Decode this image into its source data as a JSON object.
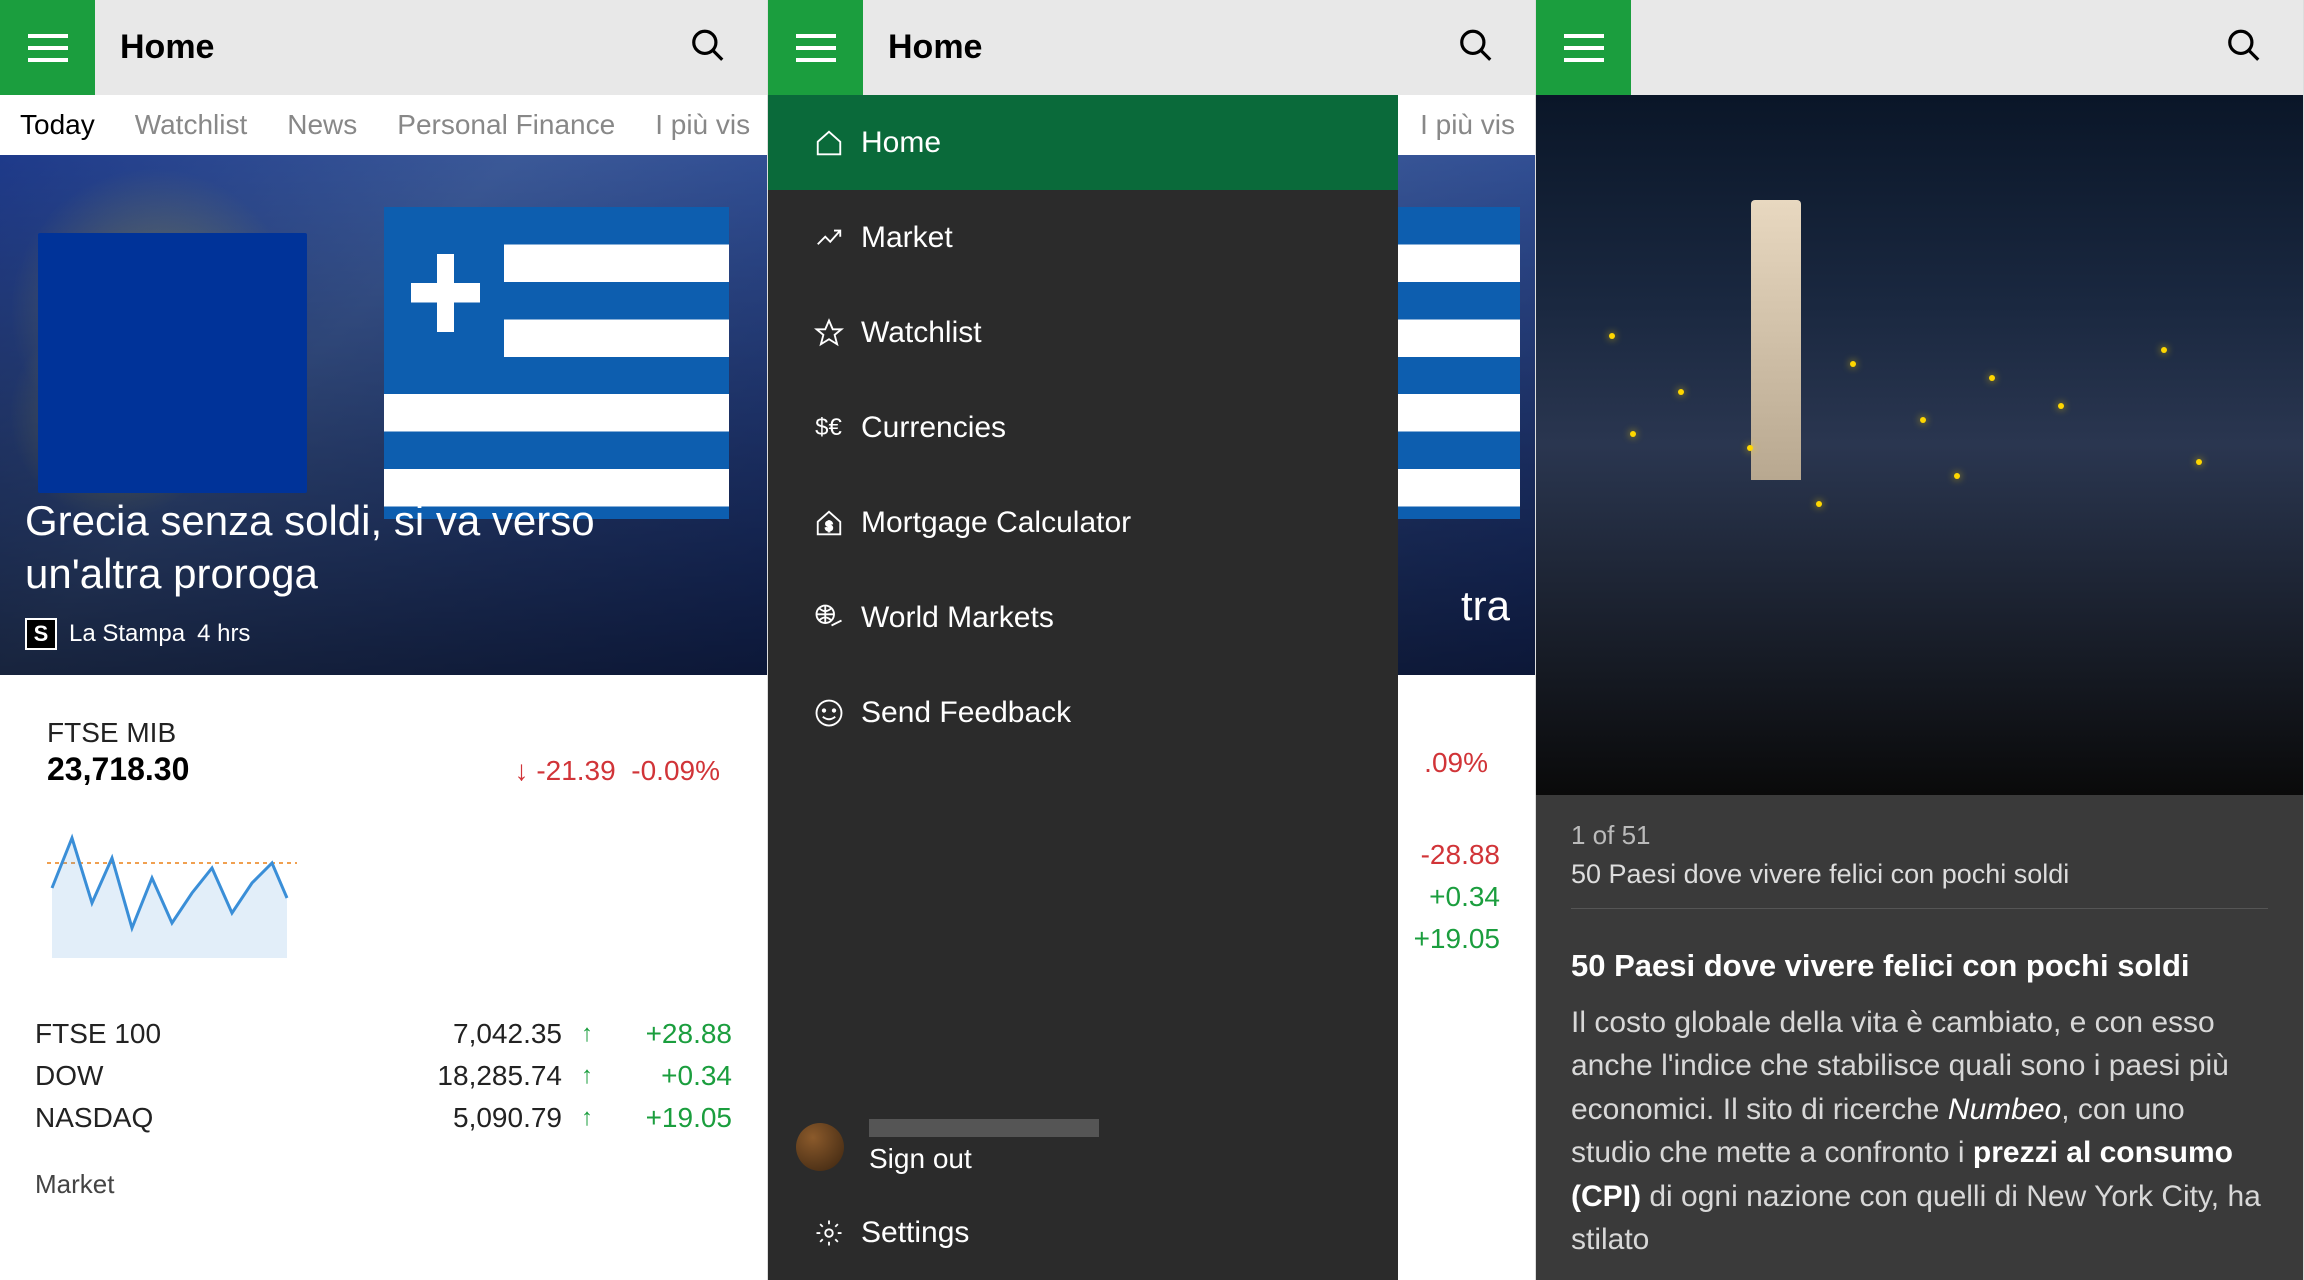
{
  "header": {
    "title": "Home"
  },
  "tabs": [
    {
      "label": "Today",
      "active": true
    },
    {
      "label": "Watchlist"
    },
    {
      "label": "News"
    },
    {
      "label": "Personal Finance"
    },
    {
      "label": "I più vis"
    }
  ],
  "tabs_p2_visible": "I più vis",
  "hero": {
    "title": "Grecia senza soldi, si va verso un'altra proroga",
    "source": "La Stampa",
    "source_badge": "S",
    "time": "4 hrs",
    "title_fragment_p2": "tra"
  },
  "market": {
    "name": "FTSE MIB",
    "value": "23,718.30",
    "change_value": "-21.39",
    "change_pct": "-0.09%",
    "change_pct_p2": ".09%"
  },
  "indices": [
    {
      "name": "FTSE 100",
      "value": "7,042.35",
      "delta": "+28.88",
      "up": true
    },
    {
      "name": "DOW",
      "value": "18,285.74",
      "delta": "+0.34",
      "up": true
    },
    {
      "name": "NASDAQ",
      "value": "5,090.79",
      "delta": "+19.05",
      "up": true
    }
  ],
  "indices_p2_deltas": [
    "-28.88",
    "+0.34",
    "+19.05"
  ],
  "section_label": "Market",
  "drawer": {
    "items": [
      {
        "icon": "home-icon",
        "label": "Home",
        "active": true
      },
      {
        "icon": "market-icon",
        "label": "Market"
      },
      {
        "icon": "watchlist-icon",
        "label": "Watchlist"
      },
      {
        "icon": "currencies-icon",
        "label": "Currencies"
      },
      {
        "icon": "mortgage-icon",
        "label": "Mortgage Calculator"
      },
      {
        "icon": "world-markets-icon",
        "label": "World Markets"
      },
      {
        "icon": "feedback-icon",
        "label": "Send Feedback"
      }
    ],
    "sign_out": "Sign out",
    "settings": "Settings"
  },
  "article": {
    "counter": "1 of 51",
    "subtitle": "50 Paesi dove vivere felici con pochi soldi",
    "headline": "50 Paesi dove vivere felici con pochi soldi",
    "body_part1": "Il costo globale della vita è cambiato, e con esso anche l'indice che stabilisce quali sono i paesi più economici. Il sito di ricerche ",
    "body_em": "Numbeo",
    "body_part2": ", con uno studio che mette a confronto i ",
    "body_strong": "prezzi al consumo (CPI)",
    "body_part3": " di ogni nazione con quelli di New York City, ha stilato"
  },
  "colors": {
    "accent": "#1b9e3e",
    "down": "#d13438",
    "up": "#1b9e3e"
  }
}
